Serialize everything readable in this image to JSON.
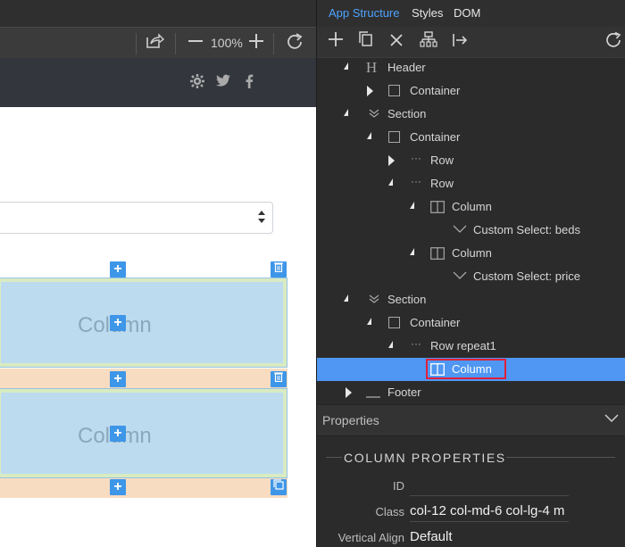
{
  "left_toolbar": {
    "zoom": "100%"
  },
  "canvas": {
    "columns": [
      {
        "label": "Column"
      },
      {
        "label": "Column"
      }
    ]
  },
  "right_panel": {
    "tabs": [
      "App Structure",
      "Styles",
      "DOM"
    ],
    "active_tab": "App Structure",
    "tree": [
      {
        "label": "Header",
        "icon": "h-icon"
      },
      {
        "label": "Container",
        "icon": "container-icon"
      },
      {
        "label": "Section",
        "icon": "section-icon"
      },
      {
        "label": "Container",
        "icon": "container-icon"
      },
      {
        "label": "Row",
        "icon": "row-icon"
      },
      {
        "label": "Row",
        "icon": "row-icon"
      },
      {
        "label": "Column",
        "icon": "column-icon"
      },
      {
        "label": "Custom Select: beds",
        "icon": "select-icon"
      },
      {
        "label": "Column",
        "icon": "column-icon"
      },
      {
        "label": "Custom Select: price",
        "icon": "select-icon"
      },
      {
        "label": "Section",
        "icon": "section-icon"
      },
      {
        "label": "Container",
        "icon": "container-icon"
      },
      {
        "label": "Row repeat1",
        "icon": "row-icon"
      },
      {
        "label": "Column",
        "icon": "column-icon"
      },
      {
        "label": "Footer",
        "icon": "footer-icon"
      }
    ],
    "properties": {
      "header": "Properties",
      "section_title": "COLUMN PROPERTIES",
      "fields": [
        {
          "label": "ID",
          "value": ""
        },
        {
          "label": "Class",
          "value": "col-12 col-md-6 col-lg-4 m"
        },
        {
          "label": "Vertical Align",
          "value": "Default"
        }
      ]
    },
    "colors": {
      "selected_row": "#4f97f3",
      "highlight_border": "#e0203a"
    }
  }
}
